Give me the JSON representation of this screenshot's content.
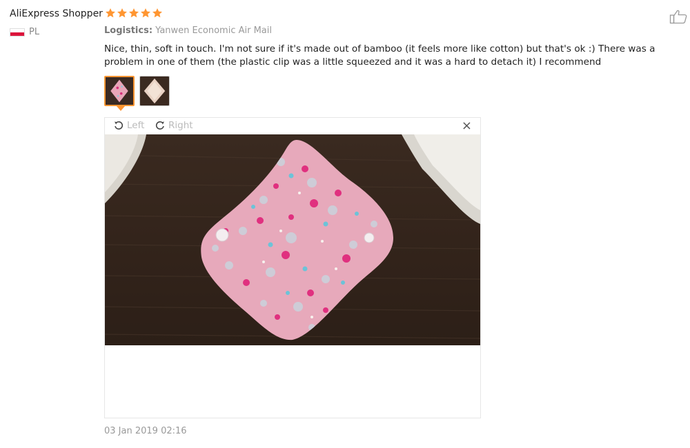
{
  "review": {
    "reviewer_name": "AliExpress Shopper",
    "rating": 5,
    "country_code": "PL",
    "logistics_label": "Logistics:",
    "logistics_value": "Yanwen Economic Air Mail",
    "text": "Nice, thin, soft in touch. I'm not sure if it's made out of bamboo (it feels more like cotton) but that's ok :) There was a problem in one of them (the plastic clip was a little squeezed and it was a hard to detach it) I recommend",
    "date": "03 Jan 2019 02:16"
  },
  "viewer": {
    "rotate_left_label": "Left",
    "rotate_right_label": "Right",
    "close_symbol": "×"
  },
  "icons": {
    "star": "star-icon",
    "like": "thumbs-up-icon",
    "rotate_left": "rotate-left-icon",
    "rotate_right": "rotate-right-icon",
    "close": "close-icon"
  },
  "colors": {
    "star": "#ff9632",
    "active_thumb_border": "#ff9632",
    "muted_text": "#999999"
  }
}
